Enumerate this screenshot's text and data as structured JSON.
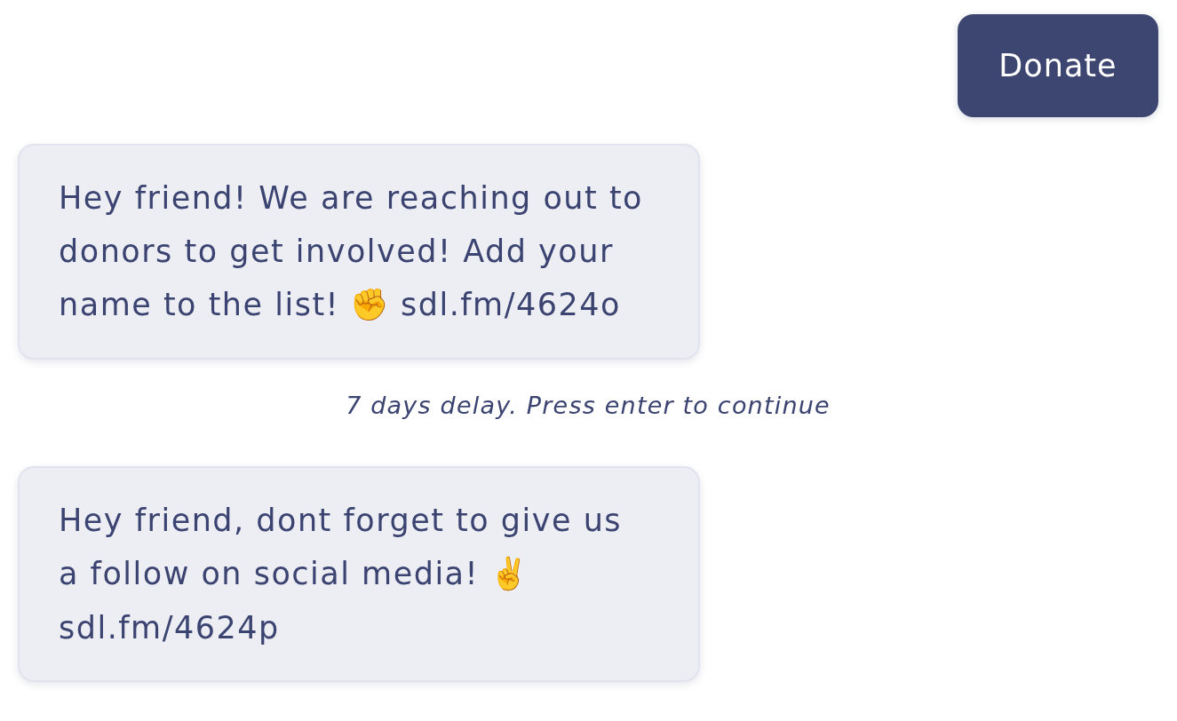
{
  "messages": [
    {
      "kind": "sent",
      "text": "Donate"
    },
    {
      "kind": "received",
      "text": "Hey friend! We are reaching out to donors to get involved! Add your name to the list! ✊ sdl.fm/4624o"
    },
    {
      "kind": "delay",
      "text": "7 days delay. Press enter to continue"
    },
    {
      "kind": "received",
      "text": "Hey friend, dont forget to give us a follow on social media! ✌️ sdl.fm/4624p"
    }
  ]
}
